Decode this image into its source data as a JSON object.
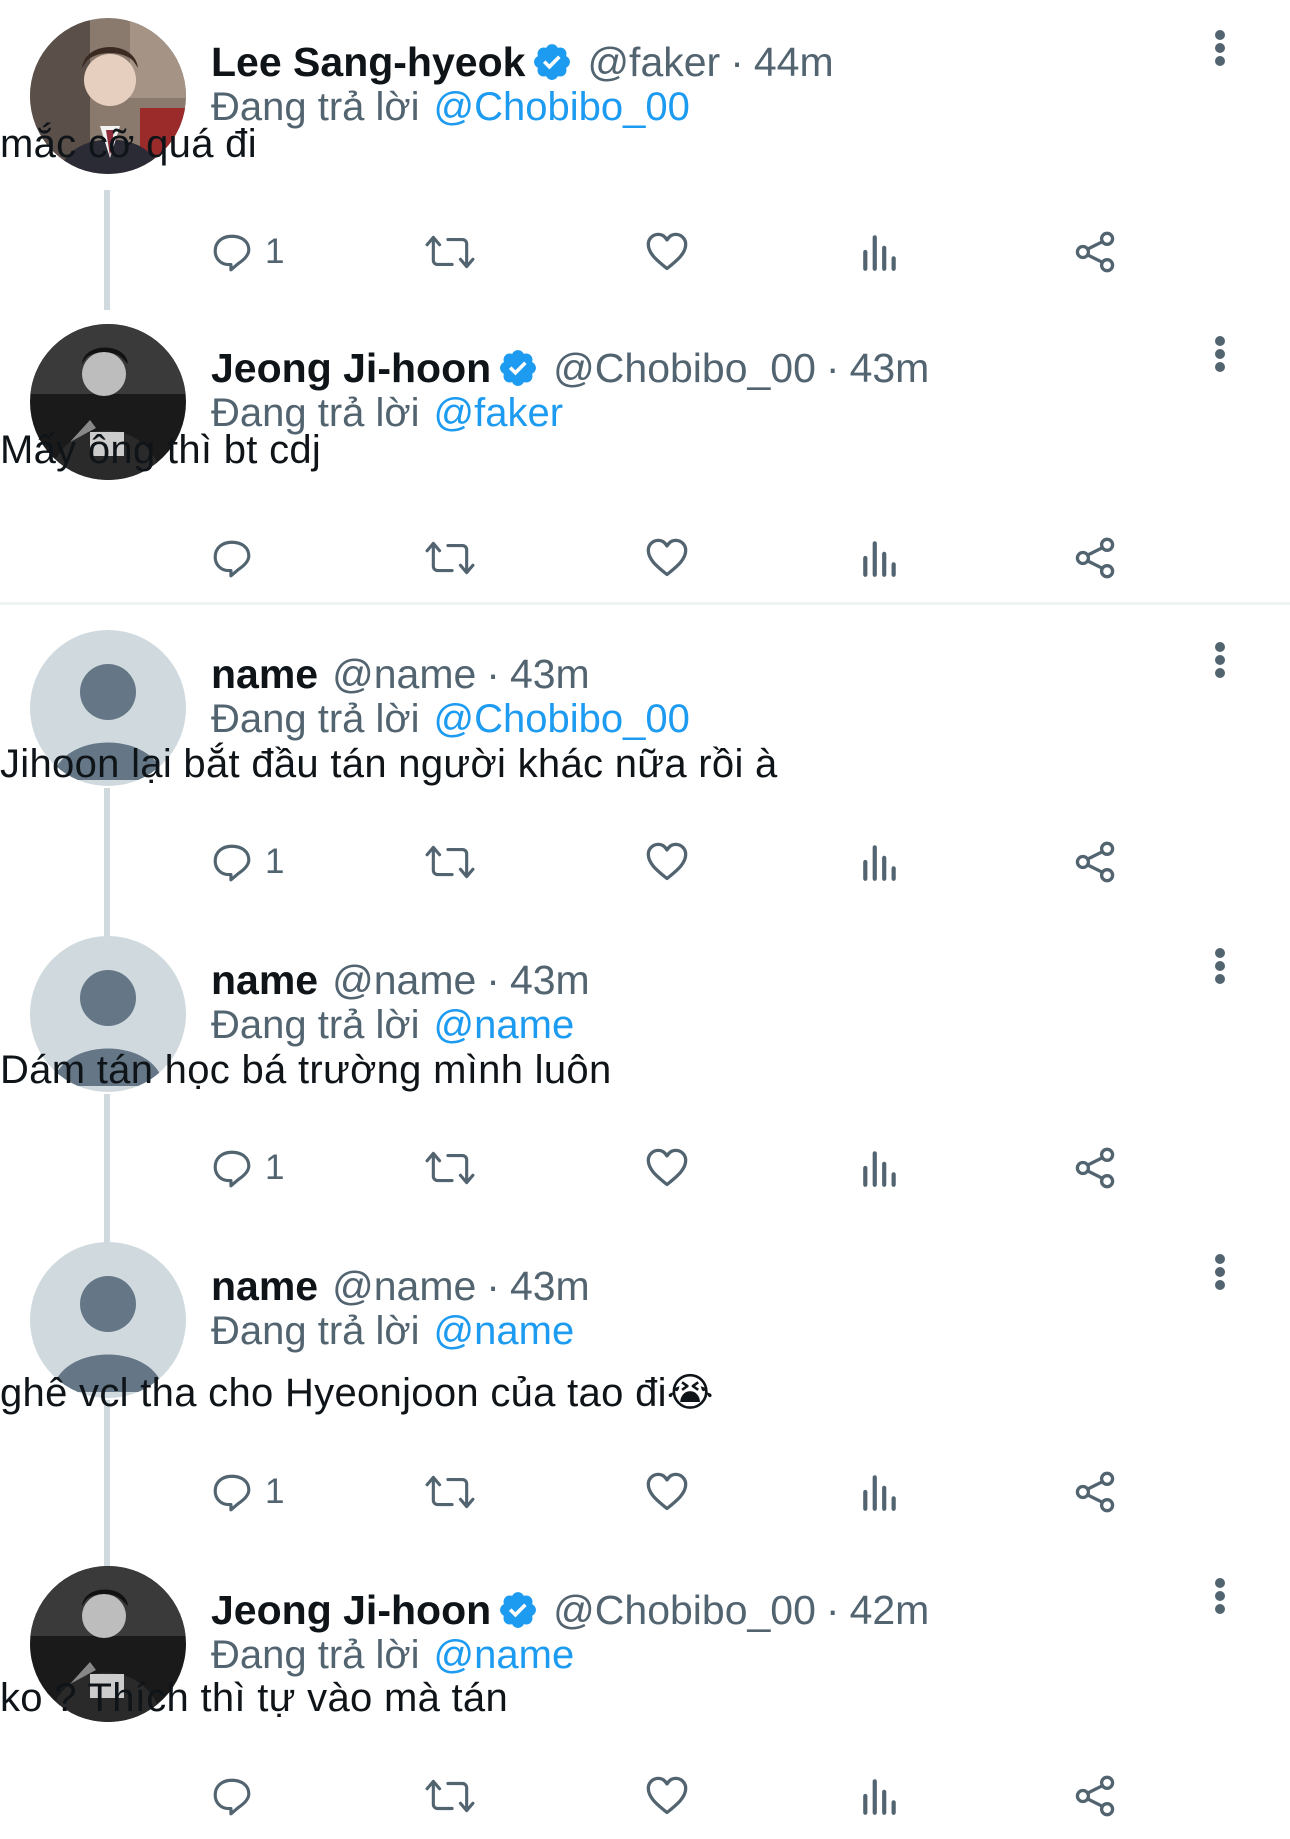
{
  "colors": {
    "accent": "#1d9bf0",
    "secondary_text": "#536471",
    "thread_line": "#cfd9de"
  },
  "tweets": [
    {
      "name": "Lee Sang-hyeok",
      "verified": true,
      "handle": "@faker",
      "dot": "·",
      "time": "44m",
      "reply_prefix": "Đang trả lời",
      "reply_to": "@Chobibo_00",
      "text": "mắc cỡ quá đi",
      "reply_count": "1",
      "avatar": "photo-faker"
    },
    {
      "name": "Jeong Ji-hoon",
      "verified": true,
      "handle": "@Chobibo_00",
      "dot": "·",
      "time": "43m",
      "reply_prefix": "Đang trả lời",
      "reply_to": "@faker",
      "text": "Mấy ông thì bt cdj",
      "reply_count": "",
      "avatar": "photo-chovy"
    },
    {
      "name": "name",
      "verified": false,
      "handle": "@name",
      "dot": "·",
      "time": "43m",
      "reply_prefix": "Đang trả lời",
      "reply_to": "@Chobibo_00",
      "text": "Jihoon lại bắt đầu tán người khác nữa rồi à",
      "reply_count": "1",
      "avatar": "default-avatar"
    },
    {
      "name": "name",
      "verified": false,
      "handle": "@name",
      "dot": "·",
      "time": "43m",
      "reply_prefix": "Đang trả lời",
      "reply_to": "@name",
      "text": "Dám tán học bá trường mình luôn",
      "reply_count": "1",
      "avatar": "default-avatar"
    },
    {
      "name": "name",
      "verified": false,
      "handle": "@name",
      "dot": "·",
      "time": "43m",
      "reply_prefix": "Đang trả lời",
      "reply_to": "@name",
      "text": "ghê vcl tha cho Hyeonjoon của tao đi😭",
      "reply_count": "1",
      "avatar": "default-avatar"
    },
    {
      "name": "Jeong Ji-hoon",
      "verified": true,
      "handle": "@Chobibo_00",
      "dot": "·",
      "time": "42m",
      "reply_prefix": "Đang trả lời",
      "reply_to": "@name",
      "text": "ko ? Thích thì tự vào mà tán",
      "reply_count": "",
      "avatar": "photo-chovy"
    }
  ],
  "action_icons": [
    "reply-icon",
    "retweet-icon",
    "like-icon",
    "views-icon",
    "share-icon"
  ]
}
